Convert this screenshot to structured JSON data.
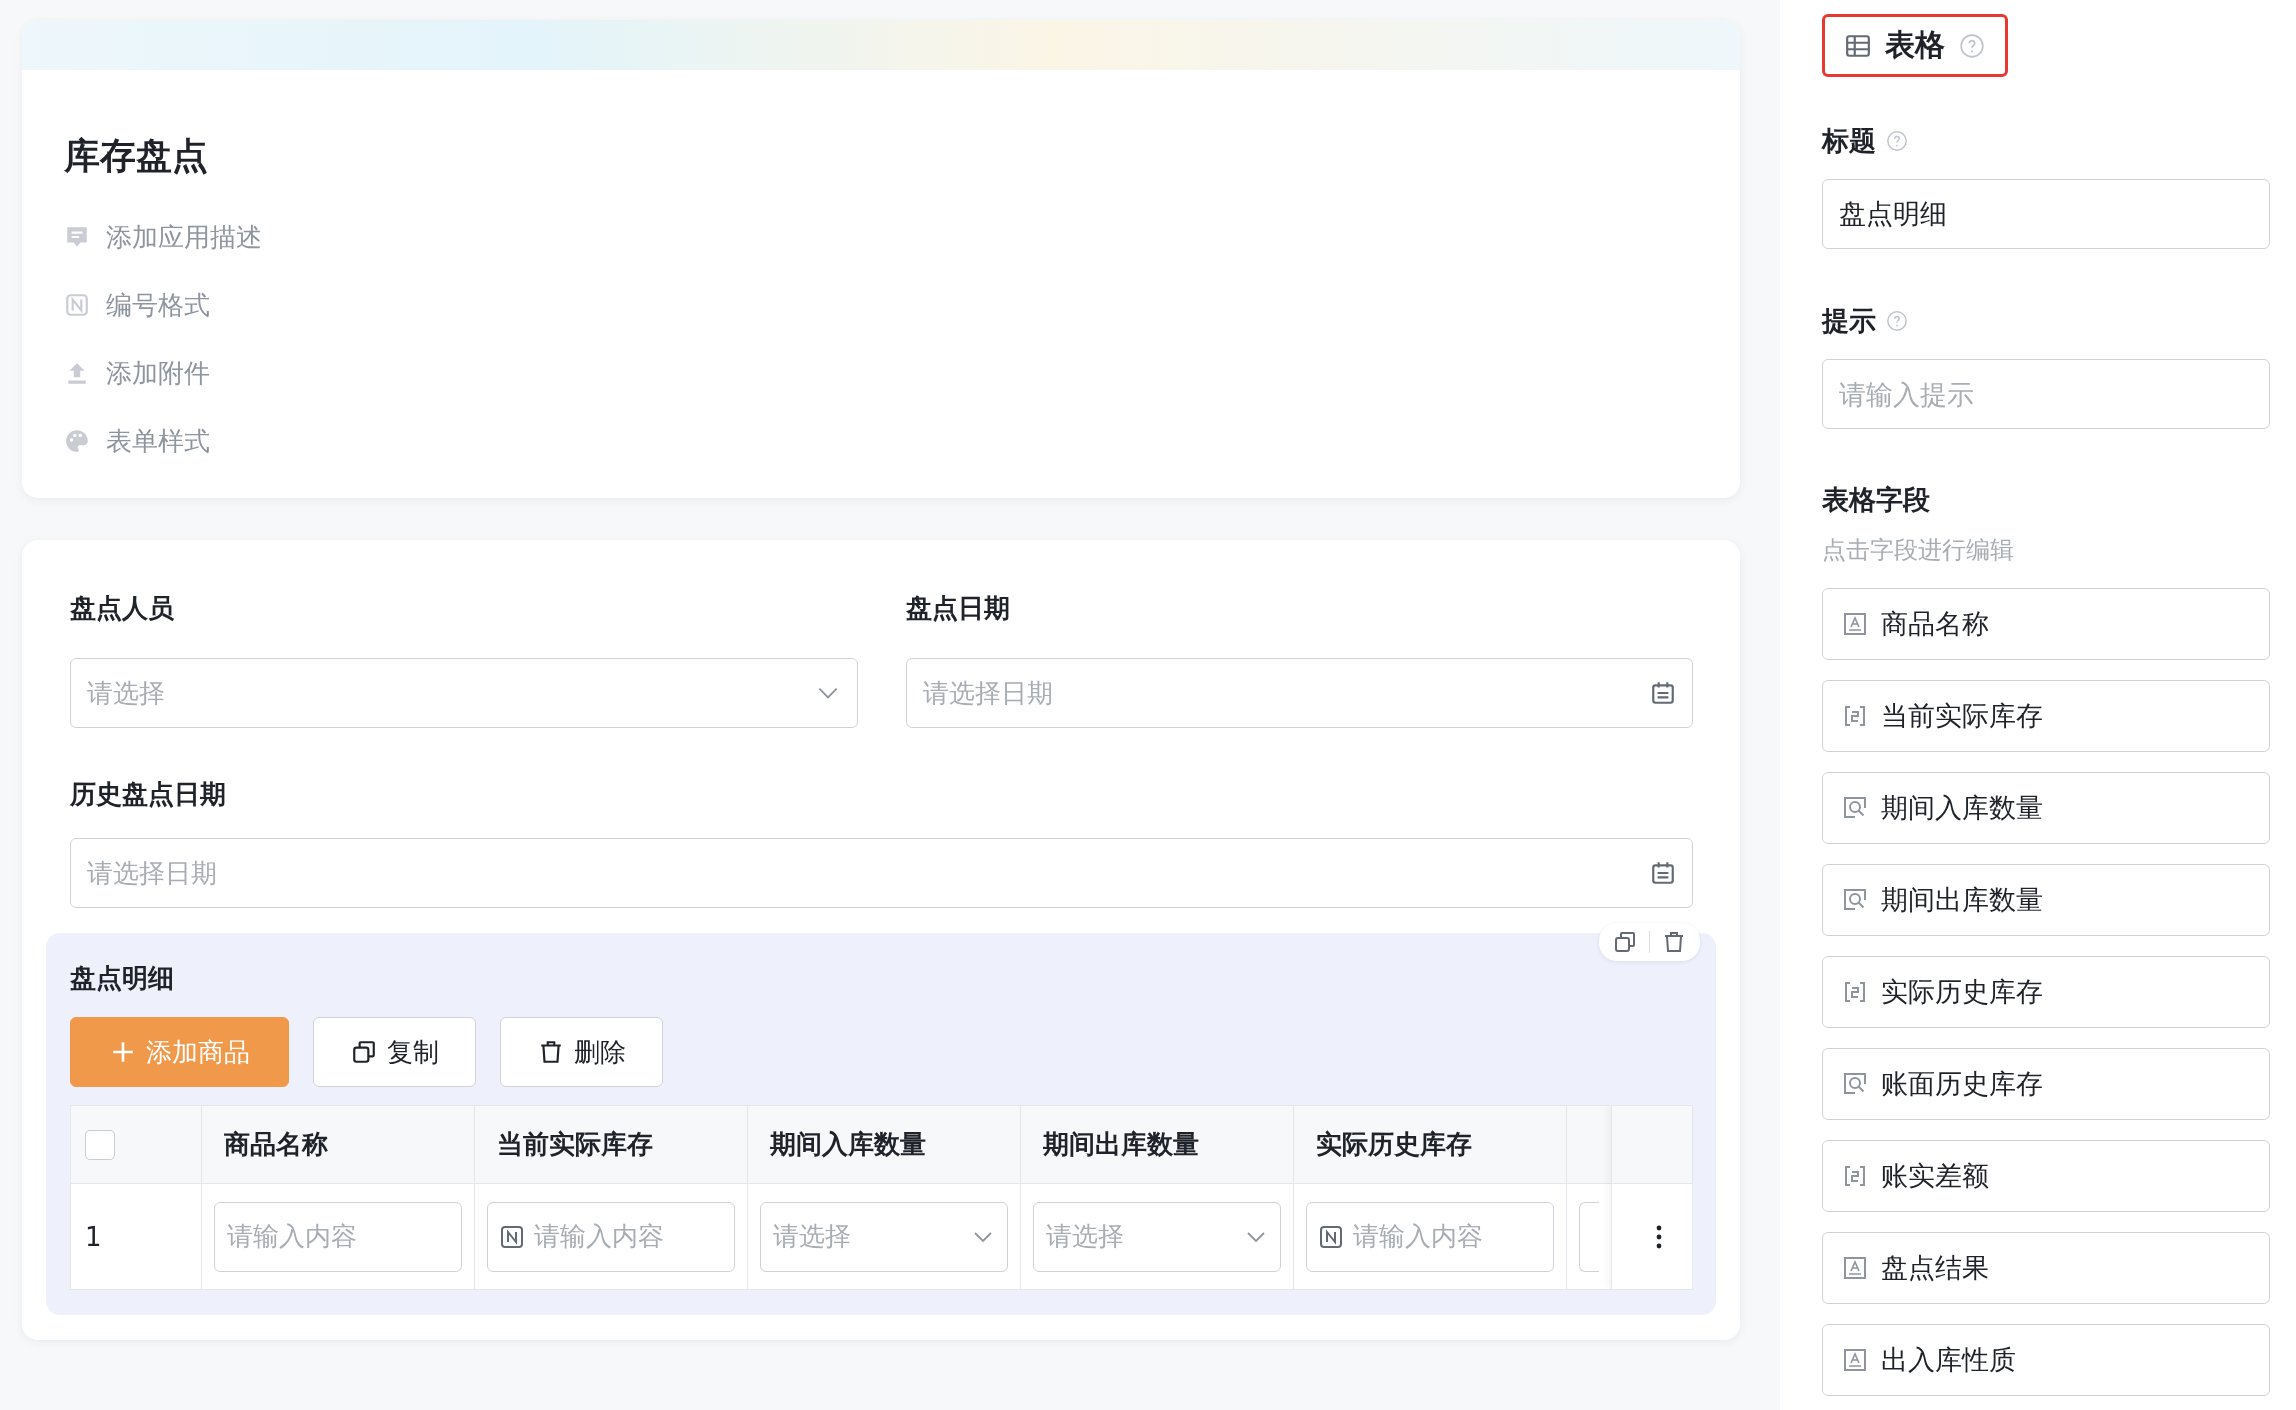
{
  "app": {
    "title": "库存盘点",
    "actions": [
      {
        "kind": "description",
        "label": "添加应用描述"
      },
      {
        "kind": "numbering",
        "label": "编号格式"
      },
      {
        "kind": "attachment",
        "label": "添加附件"
      },
      {
        "kind": "style",
        "label": "表单样式"
      }
    ]
  },
  "form": {
    "rows": [
      [
        {
          "label": "盘点人员",
          "kind": "select",
          "placeholder": "请选择"
        },
        {
          "label": "盘点日期",
          "kind": "date",
          "placeholder": "请选择日期"
        }
      ],
      [
        {
          "label": "历史盘点日期",
          "kind": "date",
          "placeholder": "请选择日期"
        }
      ]
    ],
    "subtable": {
      "title": "盘点明细",
      "buttons": [
        {
          "kind": "add",
          "label": "添加商品"
        },
        {
          "kind": "copy",
          "label": "复制"
        },
        {
          "kind": "delete",
          "label": "删除"
        }
      ],
      "select_all": {
        "checked": false
      },
      "columns": [
        {
          "label": "商品名称",
          "kind": "text",
          "placeholder": "请输入内容"
        },
        {
          "label": "当前实际库存",
          "kind": "number",
          "placeholder": "请输入内容"
        },
        {
          "label": "期间入库数量",
          "kind": "select",
          "placeholder": "请选择"
        },
        {
          "label": "期间出库数量",
          "kind": "select",
          "placeholder": "请选择"
        },
        {
          "label": "实际历史库存",
          "kind": "number",
          "placeholder": "请输入内容"
        }
      ],
      "rows": [
        {
          "index": "1"
        }
      ]
    }
  },
  "panel": {
    "tab": {
      "label": "表格",
      "selected": true
    },
    "title_field": {
      "label": "标题",
      "value": "盘点明细"
    },
    "hint_field": {
      "label": "提示",
      "placeholder": "请输入提示"
    },
    "fields_heading": "表格字段",
    "fields_hint": "点击字段进行编辑",
    "fields": [
      {
        "kind": "text",
        "label": "商品名称"
      },
      {
        "kind": "number",
        "label": "当前实际库存"
      },
      {
        "kind": "lookup",
        "label": "期间入库数量"
      },
      {
        "kind": "lookup",
        "label": "期间出库数量"
      },
      {
        "kind": "number",
        "label": "实际历史库存"
      },
      {
        "kind": "lookup",
        "label": "账面历史库存"
      },
      {
        "kind": "number",
        "label": "账实差额"
      },
      {
        "kind": "text",
        "label": "盘点结果"
      },
      {
        "kind": "text",
        "label": "出入库性质"
      }
    ]
  }
}
